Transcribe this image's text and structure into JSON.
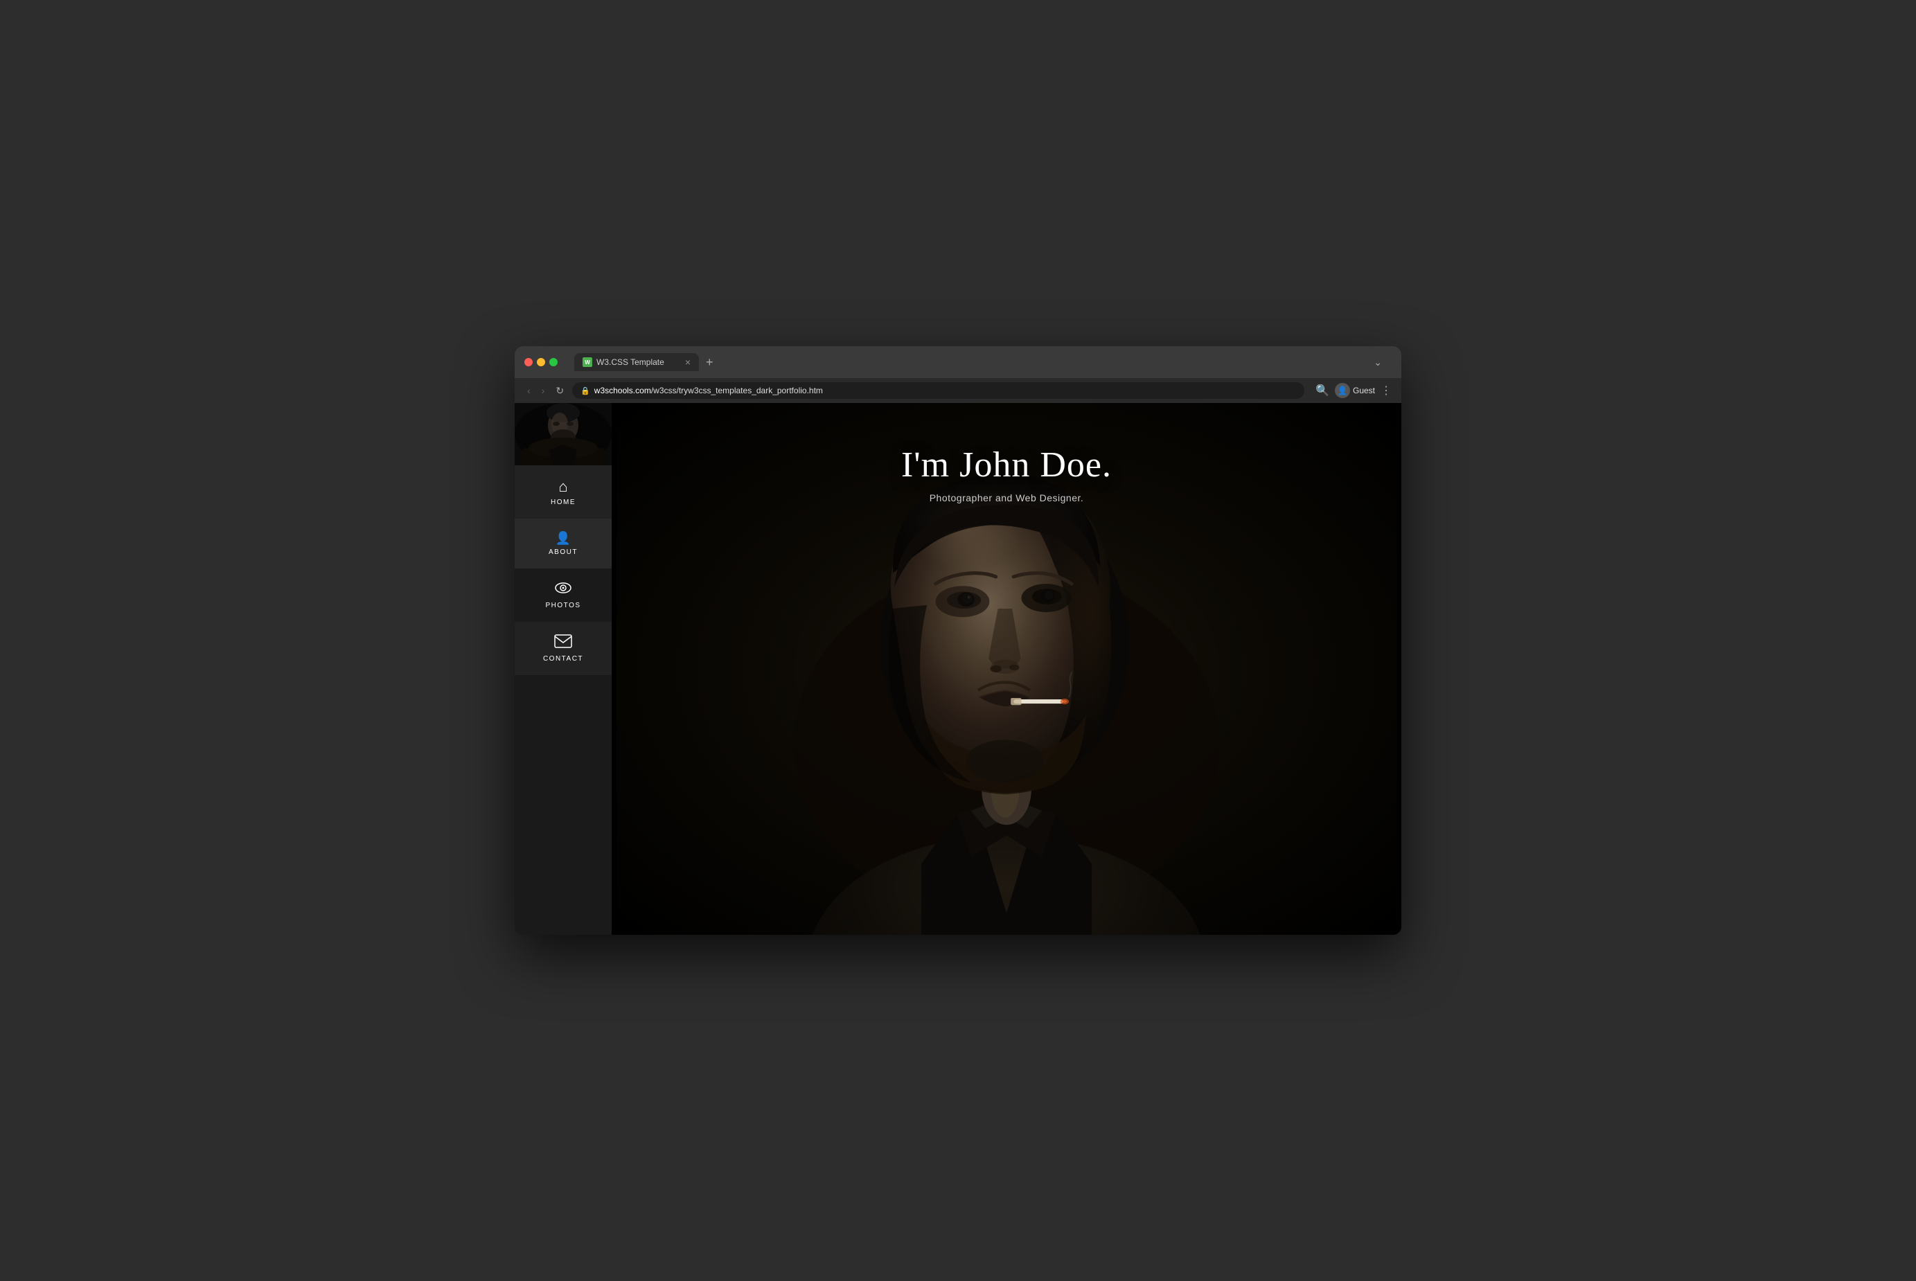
{
  "browser": {
    "tab_favicon": "W",
    "tab_title": "W3.CSS Template",
    "tab_close": "×",
    "new_tab": "+",
    "tab_overflow": "⌄",
    "nav_back": "‹",
    "nav_forward": "›",
    "nav_refresh": "↻",
    "address_lock": "🔒",
    "address_domain": "w3schools.com",
    "address_path": "/w3css/tryw3css_templates_dark_portfolio.htm",
    "search_icon": "🔍",
    "user_icon": "👤",
    "user_label": "Guest",
    "menu_icon": "⋮"
  },
  "sidebar": {
    "nav_items": [
      {
        "id": "home",
        "label": "HOME",
        "icon": "⌂",
        "active": true
      },
      {
        "id": "about",
        "label": "ABOUT",
        "icon": "👤"
      },
      {
        "id": "photos",
        "label": "PHOTOS",
        "icon": "👁"
      },
      {
        "id": "contact",
        "label": "CONTACT",
        "icon": "✉"
      }
    ]
  },
  "hero": {
    "name": "I'm John Doe.",
    "subtitle": "Photographer and Web Designer."
  },
  "colors": {
    "sidebar_bg": "#1a1a1a",
    "sidebar_hover": "#333333",
    "active_nav": "#222222",
    "main_bg": "#000000",
    "text_white": "#ffffff",
    "text_gray": "#cccccc",
    "browser_chrome": "#3a3a3a",
    "tab_bg": "#2a2a2a"
  }
}
